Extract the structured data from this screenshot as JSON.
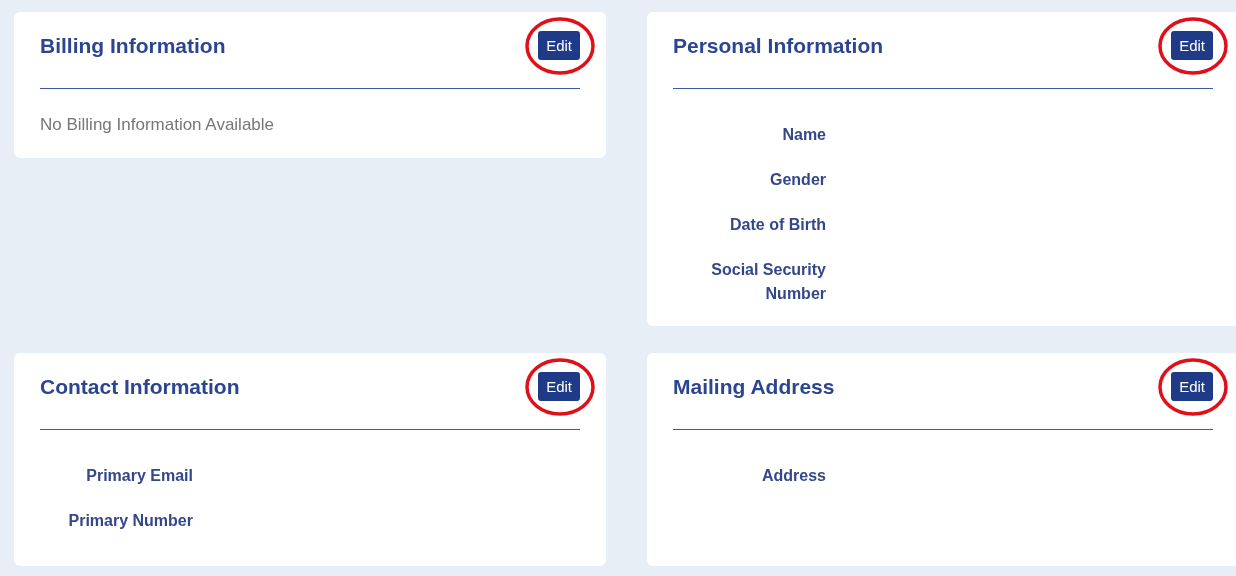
{
  "cards": [
    {
      "title": "Billing Information",
      "edit": {
        "label": "Edit",
        "highlighted": true
      },
      "kind": "message",
      "message": "No Billing Information Available"
    },
    {
      "title": "Personal Information",
      "edit": {
        "label": "Edit",
        "highlighted": true
      },
      "kind": "fields",
      "fields": [
        "Name",
        "Gender",
        "Date of Birth",
        "Social Security Number"
      ]
    },
    {
      "title": "Contact Information",
      "edit": {
        "label": "Edit",
        "highlighted": true
      },
      "kind": "fields",
      "fields": [
        "Primary Email",
        "Primary Number"
      ]
    },
    {
      "title": "Mailing Address",
      "edit": {
        "label": "Edit",
        "highlighted": true
      },
      "kind": "fields",
      "fields": [
        "Address"
      ]
    }
  ]
}
